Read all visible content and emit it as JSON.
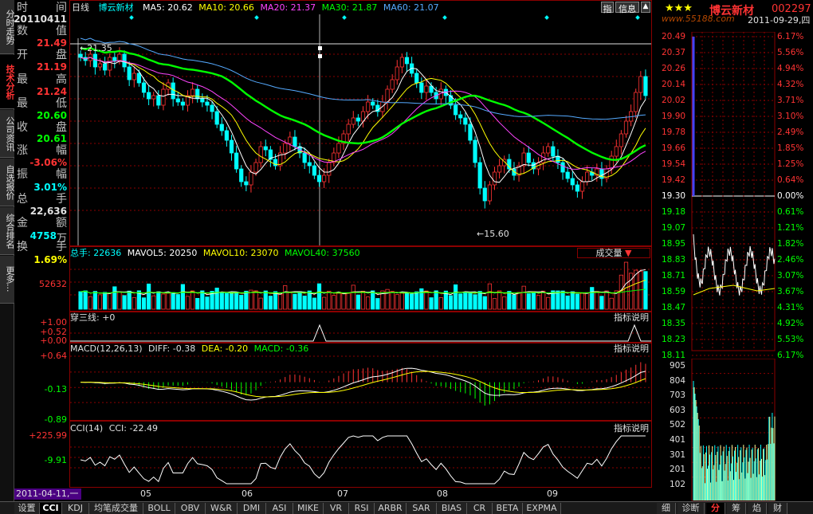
{
  "colors": {
    "up": "#ff3333",
    "down": "#00ffff",
    "ma5": "#ffffff",
    "ma10": "#ffff00",
    "ma20": "#ff44ff",
    "ma30": "#00ff00",
    "ma60": "#55aaff",
    "grid": "#8b0000"
  },
  "header": {
    "period": "日线",
    "stock_name": "博云新材",
    "ma5": "MA5: 20.62",
    "ma10": "MA10: 20.66",
    "ma20": "MA20: 21.37",
    "ma30": "MA30: 21.87",
    "ma60": "MA60: 21.07",
    "btn_index": "指",
    "btn_info": "信息"
  },
  "left_nav": [
    {
      "label": "分时走势",
      "active": false
    },
    {
      "label": "技术分析",
      "active": true
    },
    {
      "label": "公司资讯",
      "active": false
    },
    {
      "label": "自选报价",
      "active": false
    },
    {
      "label": "综合排名",
      "active": false
    },
    {
      "label": "更多...",
      "active": false
    }
  ],
  "info": {
    "time_l": "时",
    "time_r": "间",
    "time_v": "20110411",
    "open_l": "开",
    "open_r": "盘",
    "open_v": "21.49",
    "num_l": "数",
    "num_r": "值",
    "high_l": "最",
    "high_r": "高",
    "high_v": "21.19",
    "low_l": "最",
    "low_r": "低",
    "low_v": "21.24",
    "close_l": "收",
    "close_r": "盘",
    "close_v": "20.60",
    "chg_l": "涨",
    "chg_r": "幅",
    "chg_v1": "20.61",
    "chg_v": "-3.06%",
    "amp_l": "振",
    "amp_r": "幅",
    "amp_v": "3.01%",
    "vol_l": "总",
    "vol_r": "手",
    "vol_v": "22,636",
    "amt_l": "金",
    "amt_r": "额",
    "amt_v": "4758",
    "amt_u": "万",
    "turn_l": "换",
    "turn_r": "手",
    "turn_v": "1.69%"
  },
  "price_panel": {
    "high_mark": "21.35",
    "low_mark": "15.60"
  },
  "volume_panel": {
    "total": "总手: 22636",
    "mavol5": "MAVOL5: 20250",
    "mavol10": "MAVOL10: 23070",
    "mavol40": "MAVOL40: 37560",
    "selector": "成交量",
    "ylabel": "52632"
  },
  "cross3_panel": {
    "title": "穿三线: +0",
    "hint": "指标说明",
    "y1": "+1.00",
    "y2": "+0.52",
    "y3": "+0.00"
  },
  "macd_panel": {
    "title": "MACD(12,26,13)",
    "diff": "DIFF: -0.38",
    "dea": "DEA: -0.20",
    "macd": "MACD: -0.36",
    "hint": "指标说明",
    "y1": "+0.64",
    "y2": "-0.13",
    "y3": "-0.89"
  },
  "cci_panel": {
    "title": "CCI(14)",
    "cci": "CCI: -22.49",
    "hint": "指标说明",
    "y1": "+225.99",
    "y2": "-9.91"
  },
  "x_axis": {
    "date_badge": "2011-04-11,一",
    "months": [
      "05",
      "06",
      "07",
      "08",
      "09"
    ]
  },
  "bottom_tabs": [
    "设置",
    "CCI",
    "KDJ",
    "均笔成交量",
    "BOLL",
    "OBV",
    "W&R",
    "DMI",
    "ASI",
    "MIKE",
    "VR",
    "RSI",
    "ARBR",
    "SAR",
    "BIAS",
    "CR",
    "BETA",
    "EXPMA"
  ],
  "active_bottom_tab": "CCI",
  "right": {
    "stars": "★★★",
    "name": "博云新材",
    "code": "002297",
    "date": "2011-09-29,四",
    "watermark": "www.55188.com",
    "prices": [
      "20.49",
      "20.37",
      "20.26",
      "20.14",
      "20.02",
      "19.90",
      "19.78",
      "19.66",
      "19.54",
      "19.42",
      "19.30",
      "19.18",
      "19.07",
      "18.95",
      "18.83",
      "18.71",
      "18.59",
      "18.47",
      "18.35",
      "18.23",
      "18.11"
    ],
    "pcts": [
      "6.17%",
      "5.56%",
      "4.94%",
      "4.32%",
      "3.71%",
      "3.10%",
      "2.49%",
      "1.85%",
      "1.25%",
      "0.64%",
      "0.00%",
      "0.61%",
      "1.21%",
      "1.82%",
      "2.46%",
      "3.07%",
      "3.67%",
      "4.31%",
      "4.92%",
      "5.53%",
      "6.17%"
    ],
    "vols": [
      "905",
      "804",
      "703",
      "603",
      "502",
      "401",
      "301",
      "201",
      "102"
    ],
    "tabs": [
      "细",
      "诊断",
      "分",
      "筹",
      "焰",
      "财"
    ],
    "active_tab": "分"
  },
  "chart_data": {
    "type": "candlestick",
    "y_range": [
      15.6,
      21.35
    ],
    "closes": [
      20.9,
      20.8,
      21.0,
      20.6,
      20.7,
      20.5,
      20.9,
      20.8,
      21.0,
      20.6,
      20.2,
      20.4,
      20.1,
      19.8,
      19.6,
      19.7,
      19.4,
      19.9,
      20.1,
      19.6,
      19.5,
      19.4,
      19.7,
      19.9,
      19.6,
      19.5,
      19.4,
      19.2,
      18.8,
      18.6,
      18.3,
      17.9,
      17.4,
      17.0,
      16.9,
      17.3,
      17.6,
      18.1,
      18.0,
      17.7,
      17.5,
      17.9,
      18.2,
      18.4,
      18.1,
      17.9,
      17.6,
      17.5,
      17.2,
      17.0,
      17.2,
      17.6,
      17.9,
      18.2,
      18.5,
      18.8,
      19.0,
      18.9,
      19.2,
      19.5,
      19.4,
      19.2,
      19.5,
      19.9,
      20.2,
      20.6,
      20.9,
      20.7,
      20.4,
      20.1,
      19.8,
      20.0,
      19.8,
      19.6,
      19.9,
      19.7,
      19.4,
      19.1,
      19.0,
      18.8,
      18.3,
      17.6,
      16.8,
      16.4,
      16.9,
      17.3,
      17.5,
      17.7,
      17.4,
      17.2,
      17.5,
      17.9,
      17.6,
      17.4,
      17.6,
      17.9,
      18.1,
      17.8,
      17.6,
      17.3,
      17.1,
      16.9,
      16.7,
      17.0,
      17.3,
      17.2,
      17.4,
      17.1,
      17.4,
      17.8,
      18.1,
      18.5,
      18.9,
      19.2,
      19.8,
      20.3,
      19.7
    ],
    "volume_y_max": 52632,
    "macd_y_range": [
      -0.89,
      0.64
    ],
    "cci_y_range": [
      -9.91,
      225.99
    ]
  }
}
